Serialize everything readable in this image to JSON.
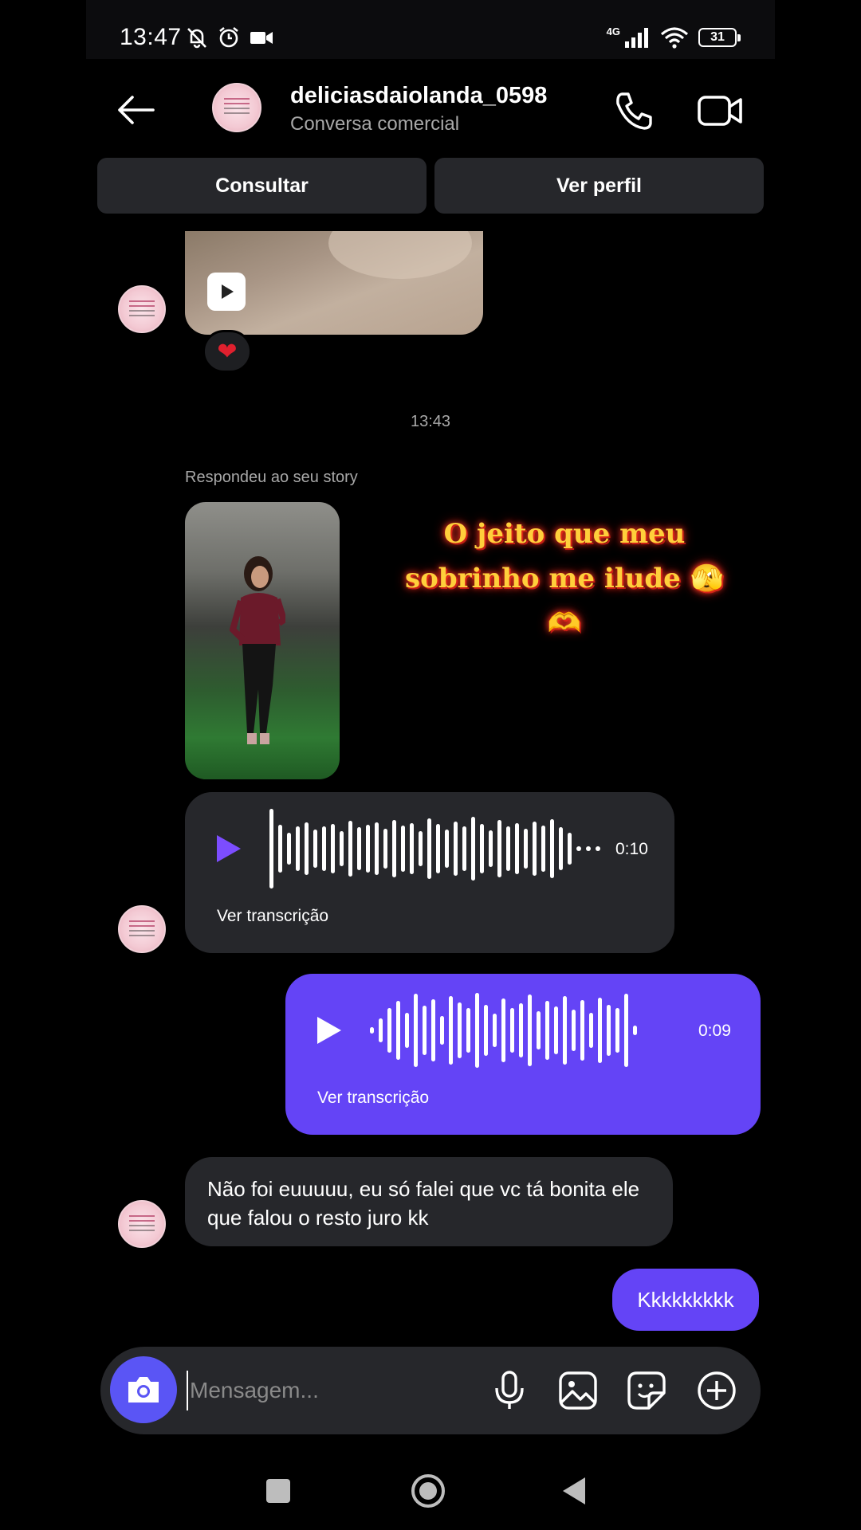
{
  "status_bar": {
    "time": "13:47",
    "network": "4G",
    "battery": "31"
  },
  "header": {
    "username": "deliciasdaiolanda_0598",
    "subtitle": "Conversa comercial"
  },
  "actions": {
    "consult_label": "Consultar",
    "profile_label": "Ver perfil"
  },
  "chat": {
    "reaction": "❤",
    "timestamp": "13:43",
    "story_reply_label": "Respondeu ao seu story",
    "story_caption": "O jeito que meu sobrinho me ilude 🫣🫶",
    "incoming_audio": {
      "duration": "0:10",
      "transcribe_label": "Ver transcrição"
    },
    "outgoing_audio": {
      "duration": "0:09",
      "transcribe_label": "Ver transcrição"
    },
    "incoming_text": "Não foi euuuuu, eu só falei que vc tá bonita ele que falou o resto juro kk",
    "outgoing_text": "Kkkkkkkkk"
  },
  "composer": {
    "placeholder": "Mensagem..."
  },
  "icons": {
    "back": "back-arrow-icon",
    "call": "phone-icon",
    "video": "video-camera-icon",
    "camera": "camera-icon",
    "mic": "microphone-icon",
    "gallery": "image-icon",
    "sticker": "sticker-icon",
    "add": "plus-circle-icon"
  },
  "colors": {
    "accent": "#6444f6",
    "camera_button": "#5a55f5",
    "incoming_bubble": "#26272b",
    "play_in": "#7c4dff"
  }
}
